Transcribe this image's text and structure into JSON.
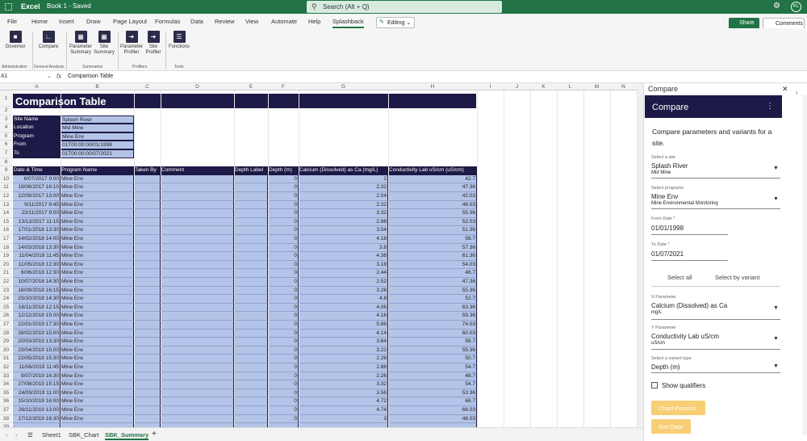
{
  "topbar": {
    "app": "Excel",
    "book": "Book 1  -  Saved",
    "search_placeholder": "Search (Alt + Q)",
    "avatar": "KL"
  },
  "menu": [
    "File",
    "Home",
    "Insert",
    "Draw",
    "Page Layout",
    "Formulas",
    "Data",
    "Review",
    "View",
    "Automate",
    "Help",
    "Splashback"
  ],
  "editing": "Editing",
  "share": "Share",
  "comments": "Comments",
  "ribbon": {
    "governor": "Governor",
    "compare": "Compare",
    "param_summary": "Parameter Summary",
    "site_summary": "Site Summary",
    "param_profiler": "Parameter Profiler",
    "site_profiler": "Site Profiler",
    "functions": "Functions",
    "groups": {
      "admin": "Administration",
      "general": "General Analysis",
      "summaries": "Summaries",
      "profilers": "Profilers",
      "tools": "Tools"
    }
  },
  "formula": {
    "namebox": "A1",
    "fx": "fx",
    "value": "Comparison Table"
  },
  "columns": [
    "A",
    "B",
    "C",
    "D",
    "E",
    "F",
    "G",
    "H",
    "I",
    "J",
    "K",
    "L",
    "M",
    "N"
  ],
  "rows": [
    "1",
    "2",
    "3",
    "4",
    "5",
    "6",
    "7",
    "8",
    "9",
    "10",
    "11",
    "12",
    "13",
    "14",
    "15",
    "16",
    "17",
    "18",
    "19",
    "20",
    "21",
    "22",
    "23",
    "24",
    "25",
    "26",
    "27",
    "28",
    "29",
    "30",
    "31",
    "32",
    "33",
    "34",
    "35",
    "36",
    "37",
    "38",
    "39"
  ],
  "title": "Comparison Table",
  "info": [
    {
      "k": "Site Name",
      "v": "Splash River"
    },
    {
      "k": "Location",
      "v": "Mid Mine"
    },
    {
      "k": "Program",
      "v": "Mine Env"
    },
    {
      "k": "From",
      "v": "01T00:00:00/01/1998"
    },
    {
      "k": "To",
      "v": "01T00:00:00/07/2021"
    }
  ],
  "headers": [
    "Date & Time",
    "Program Name",
    "Taken By",
    "Comment",
    "Depth Label",
    "Depth (m)",
    "Calcium (Dissolved) as Ca (mg/L)",
    "Conductivity Lab uS/cm (uS/cm)"
  ],
  "data": [
    [
      "6/07/2017 9:00",
      "Mine Env",
      "0",
      "2",
      "42.7"
    ],
    [
      "19/08/2017 16:10",
      "Mine Env",
      "0",
      "2.32",
      "47.36"
    ],
    [
      "12/09/2017 13:00",
      "Mine Env",
      "0",
      "2.04",
      "42.03"
    ],
    [
      "9/11/2017 9:45",
      "Mine Env",
      "0",
      "2.32",
      "46.03"
    ],
    [
      "23/11/2017 9:00",
      "Mine Env",
      "0",
      "3.32",
      "55.36"
    ],
    [
      "13/12/2017 11:15",
      "Mine Env",
      "0",
      "2.86",
      "52.03"
    ],
    [
      "17/01/2018 13:30",
      "Mine Env",
      "0",
      "3.54",
      "51.36"
    ],
    [
      "14/02/2018 14:00",
      "Mine Env",
      "0",
      "4.18",
      "56.7"
    ],
    [
      "14/03/2018 13:30",
      "Mine Env",
      "0",
      "3.8",
      "57.36"
    ],
    [
      "11/04/2018 11:45",
      "Mine Env",
      "0",
      "4.38",
      "61.36"
    ],
    [
      "11/05/2018 12:30",
      "Mine Env",
      "0",
      "3.18",
      "54.03"
    ],
    [
      "6/06/2018 12:30",
      "Mine Env",
      "0",
      "2.44",
      "46.7"
    ],
    [
      "10/07/2018 14:30",
      "Mine Env",
      "0",
      "2.52",
      "47.36"
    ],
    [
      "18/09/2018 16:15",
      "Mine Env",
      "0",
      "3.26",
      "55.36"
    ],
    [
      "23/10/2018 14:30",
      "Mine Env",
      "0",
      "4.8",
      "52.7"
    ],
    [
      "16/11/2018 12:15",
      "Mine Env",
      "0",
      "4.06",
      "63.36"
    ],
    [
      "12/12/2018 15:00",
      "Mine Env",
      "0",
      "4.16",
      "59.36"
    ],
    [
      "22/01/2019 17:30",
      "Mine Env",
      "0",
      "5.96",
      "74.03"
    ],
    [
      "28/02/2019 15:00",
      "Mine Env",
      "0",
      "4.14",
      "60.03"
    ],
    [
      "20/03/2019 13:30",
      "Mine Env",
      "0",
      "3.64",
      "58.7"
    ],
    [
      "23/04/2019 15:00",
      "Mine Env",
      "0",
      "3.22",
      "55.36"
    ],
    [
      "22/05/2019 15:30",
      "Mine Env",
      "0",
      "2.26",
      "50.7"
    ],
    [
      "11/06/2019 11:45",
      "Mine Env",
      "0",
      "2.88",
      "54.7"
    ],
    [
      "9/07/2019 16:30",
      "Mine Env",
      "0",
      "2.26",
      "48.7"
    ],
    [
      "27/08/2019 15:15",
      "Mine Env",
      "0",
      "3.32",
      "54.7"
    ],
    [
      "24/09/2019 11:00",
      "Mine Env",
      "0",
      "3.56",
      "53.36"
    ],
    [
      "15/10/2019 16:00",
      "Mine Env",
      "0",
      "4.72",
      "66.7"
    ],
    [
      "26/11/2019 13:00",
      "Mine Env",
      "0",
      "4.74",
      "66.03"
    ],
    [
      "17/12/2019 16:30",
      "Mine Env",
      "0",
      "3",
      "48.03"
    ]
  ],
  "sheet_tabs": [
    "Sheet1",
    "SBK_Chart",
    "SBK_Summary"
  ],
  "pane": {
    "title": "Compare",
    "header": "Compare",
    "lead": "Compare parameters and variants for a site.",
    "site_label": "Select a site",
    "site_value": "Splash River",
    "site_sub": "Mid Mine",
    "prog_label": "Select programs",
    "prog_value": "Mine Env",
    "prog_sub": "Mine Environmental Monitoring",
    "from_label": "From Date *",
    "from_value": "01/01/1998",
    "to_label": "To Date *",
    "to_value": "01/07/2021",
    "tab_all": "Select all",
    "tab_variant": "Select by variant",
    "x_label": "X Parameter",
    "x_value": "Calcium (Dissolved) as Ca",
    "x_unit": "mg/L",
    "y_label": "Y Parameter",
    "y_value": "Conductivity Lab uS/cm",
    "y_unit": "uS/cm",
    "vt_label": "Select a variant type",
    "vt_value": "Depth (m)",
    "qualifiers": "Show qualifiers",
    "chart_presets": "Chart Presets",
    "get_data": "Get Data"
  }
}
